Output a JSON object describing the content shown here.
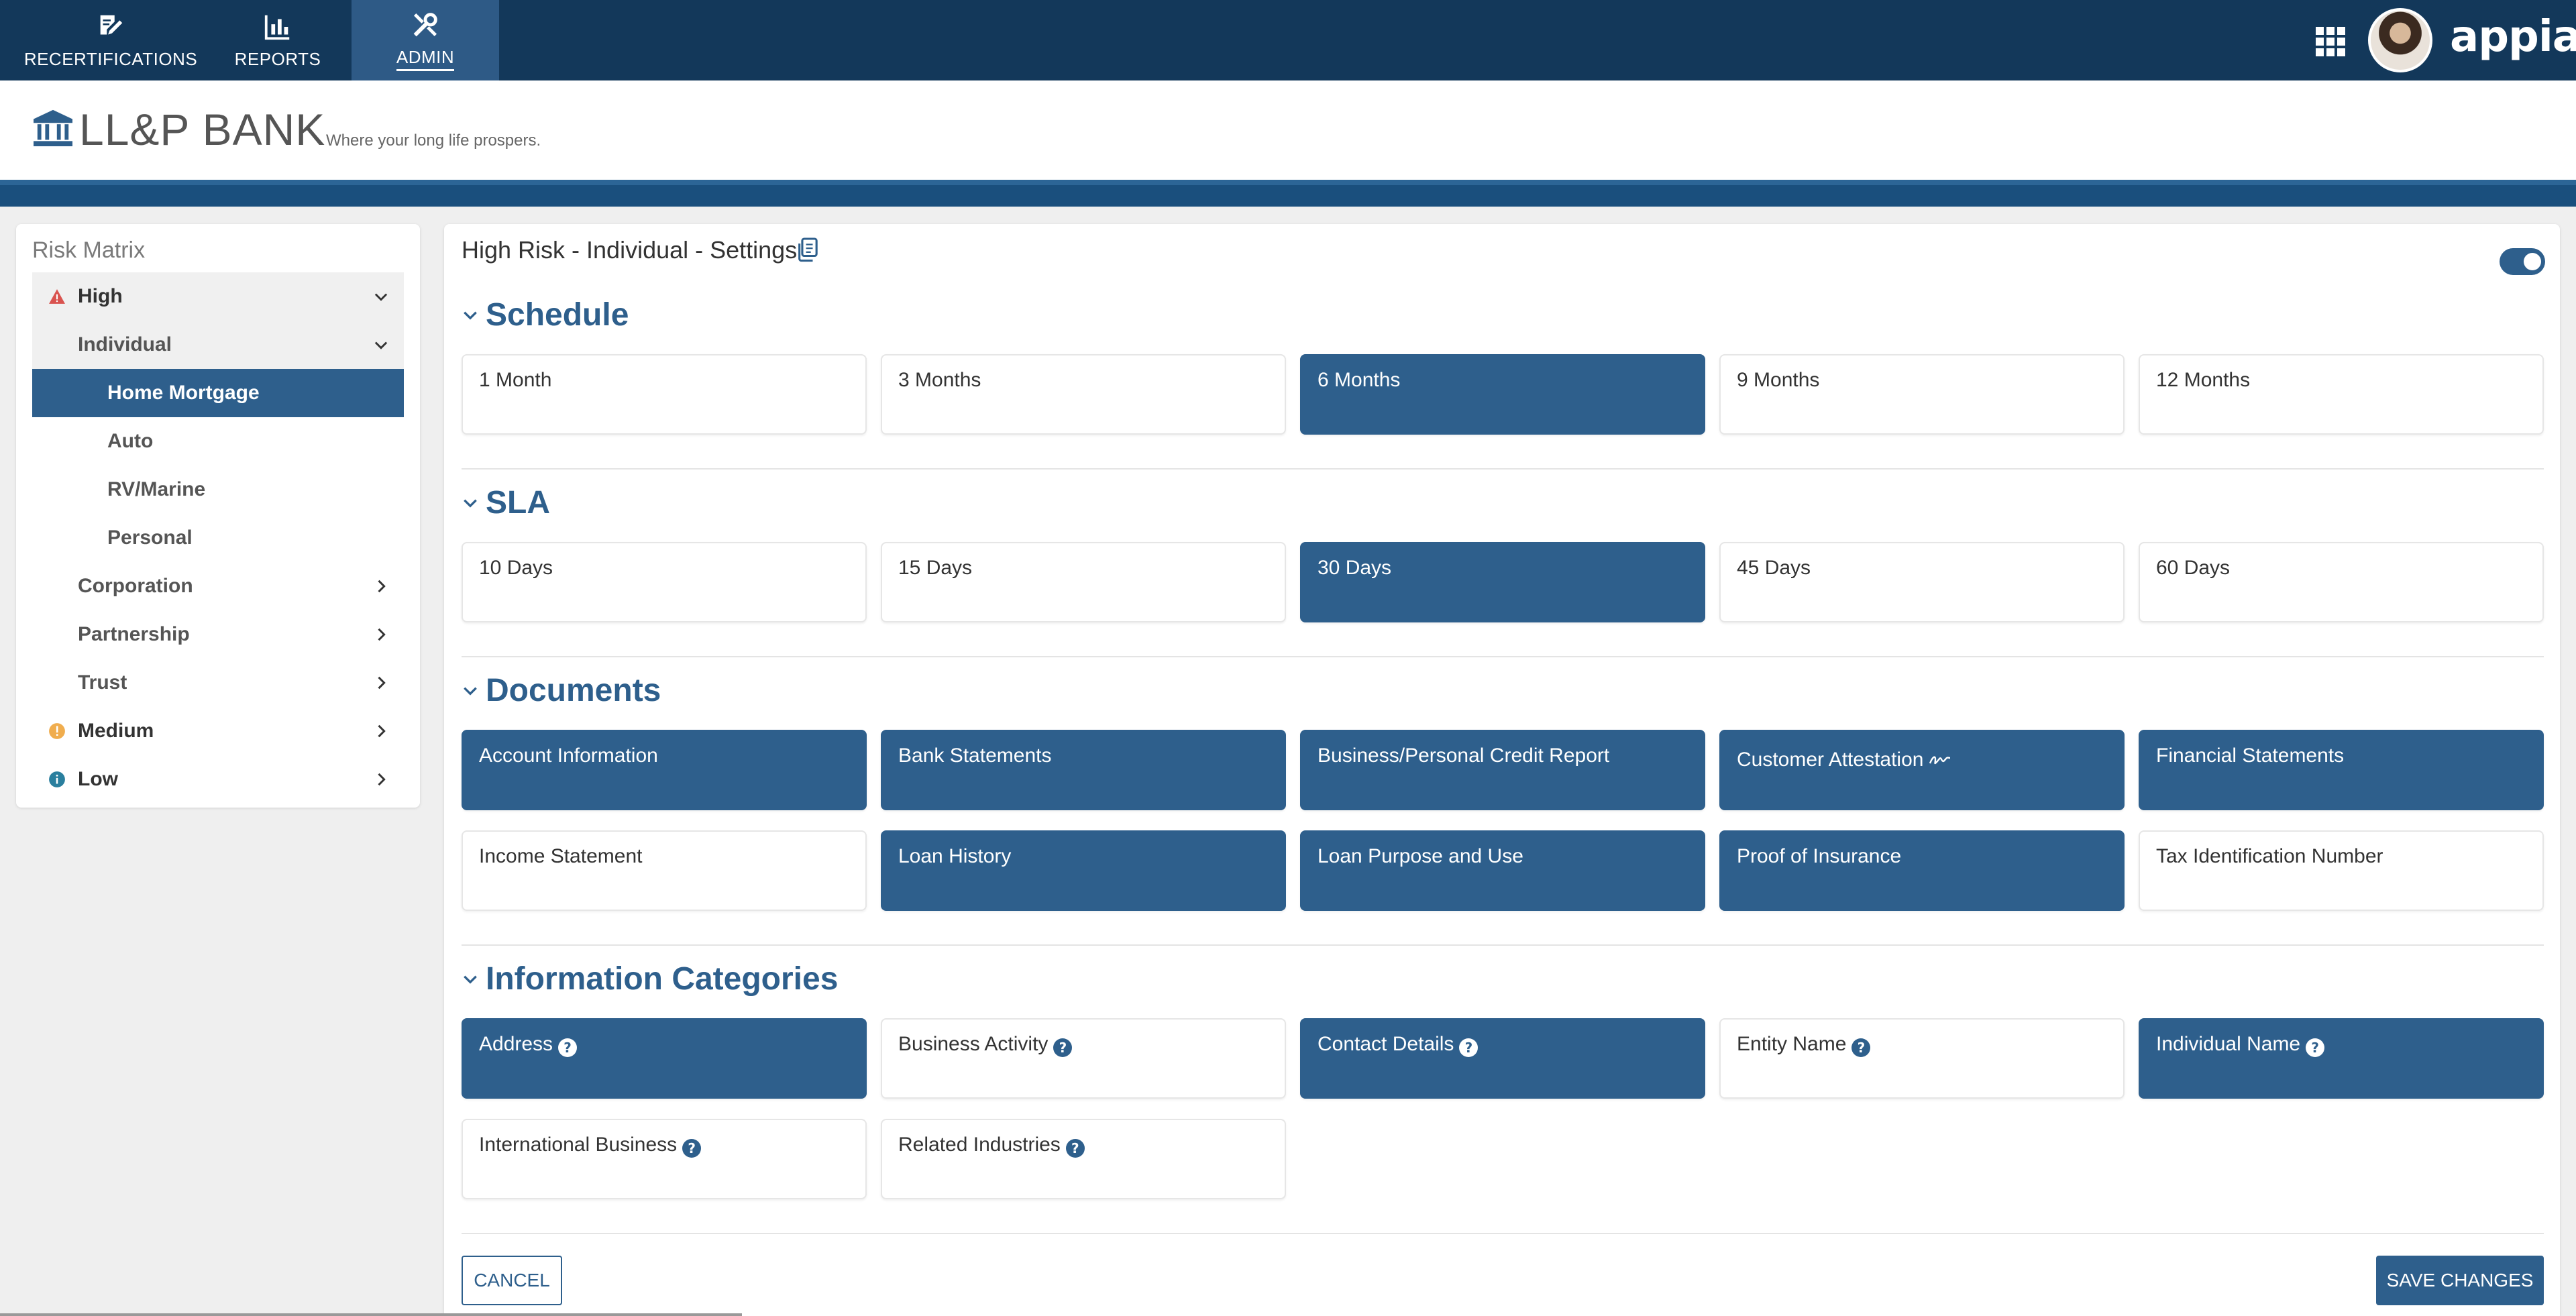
{
  "topnav": {
    "tabs": [
      {
        "label": "RECERTIFICATIONS",
        "icon": "edit-document-icon"
      },
      {
        "label": "REPORTS",
        "icon": "bar-chart-icon"
      },
      {
        "label": "ADMIN",
        "icon": "tools-icon"
      }
    ],
    "active_tab": "ADMIN",
    "brand": "appian",
    "bg_color": "#13385a",
    "active_color": "#2e5a86"
  },
  "header": {
    "bank_name": "LL&P BANK",
    "tagline": "Where your long life prospers."
  },
  "sidebar": {
    "title": "Risk Matrix",
    "items": [
      {
        "label": "High",
        "status": "warning",
        "expanded": true
      },
      {
        "label": "Individual",
        "expanded": true
      },
      {
        "label": "Home Mortgage",
        "selected": true
      },
      {
        "label": "Auto"
      },
      {
        "label": "RV/Marine"
      },
      {
        "label": "Personal"
      },
      {
        "label": "Corporation",
        "expanded": false
      },
      {
        "label": "Partnership",
        "expanded": false
      },
      {
        "label": "Trust",
        "expanded": false
      },
      {
        "label": "Medium",
        "status": "caution",
        "expanded": false
      },
      {
        "label": "Low",
        "status": "info",
        "expanded": false
      }
    ]
  },
  "main": {
    "title": "High Risk - Individual -  Settings",
    "toggle_on": true,
    "sections": {
      "schedule": {
        "title": "Schedule",
        "options": [
          {
            "label": "1 Month",
            "selected": false
          },
          {
            "label": "3 Months",
            "selected": false
          },
          {
            "label": "6 Months",
            "selected": true
          },
          {
            "label": "9 Months",
            "selected": false
          },
          {
            "label": "12 Months",
            "selected": false
          }
        ]
      },
      "sla": {
        "title": "SLA",
        "options": [
          {
            "label": "10 Days",
            "selected": false
          },
          {
            "label": "15 Days",
            "selected": false
          },
          {
            "label": "30 Days",
            "selected": true
          },
          {
            "label": "45 Days",
            "selected": false
          },
          {
            "label": "60 Days",
            "selected": false
          }
        ]
      },
      "documents": {
        "title": "Documents",
        "options": [
          {
            "label": "Account Information",
            "selected": true
          },
          {
            "label": "Bank Statements",
            "selected": true
          },
          {
            "label": "Business/Personal Credit Report",
            "selected": true
          },
          {
            "label": "Customer Attestation",
            "selected": true,
            "icon": "signature-icon"
          },
          {
            "label": "Financial Statements",
            "selected": true
          },
          {
            "label": "Income Statement",
            "selected": false
          },
          {
            "label": "Loan History",
            "selected": true
          },
          {
            "label": "Loan Purpose and Use",
            "selected": true
          },
          {
            "label": "Proof of Insurance",
            "selected": true
          },
          {
            "label": "Tax Identification Number",
            "selected": false
          }
        ]
      },
      "info_categories": {
        "title": "Information Categories",
        "options": [
          {
            "label": "Address",
            "selected": true
          },
          {
            "label": "Business Activity",
            "selected": false
          },
          {
            "label": "Contact Details",
            "selected": true
          },
          {
            "label": "Entity Name",
            "selected": false
          },
          {
            "label": "Individual Name",
            "selected": true
          },
          {
            "label": "International Business",
            "selected": false
          },
          {
            "label": "Related Industries",
            "selected": false
          }
        ]
      }
    },
    "buttons": {
      "cancel": "CANCEL",
      "save": "SAVE CHANGES"
    }
  },
  "colors": {
    "accent": "#2e5f8c",
    "warning": "#d9534f",
    "caution": "#f0ad4e",
    "info": "#2a7f9e"
  }
}
